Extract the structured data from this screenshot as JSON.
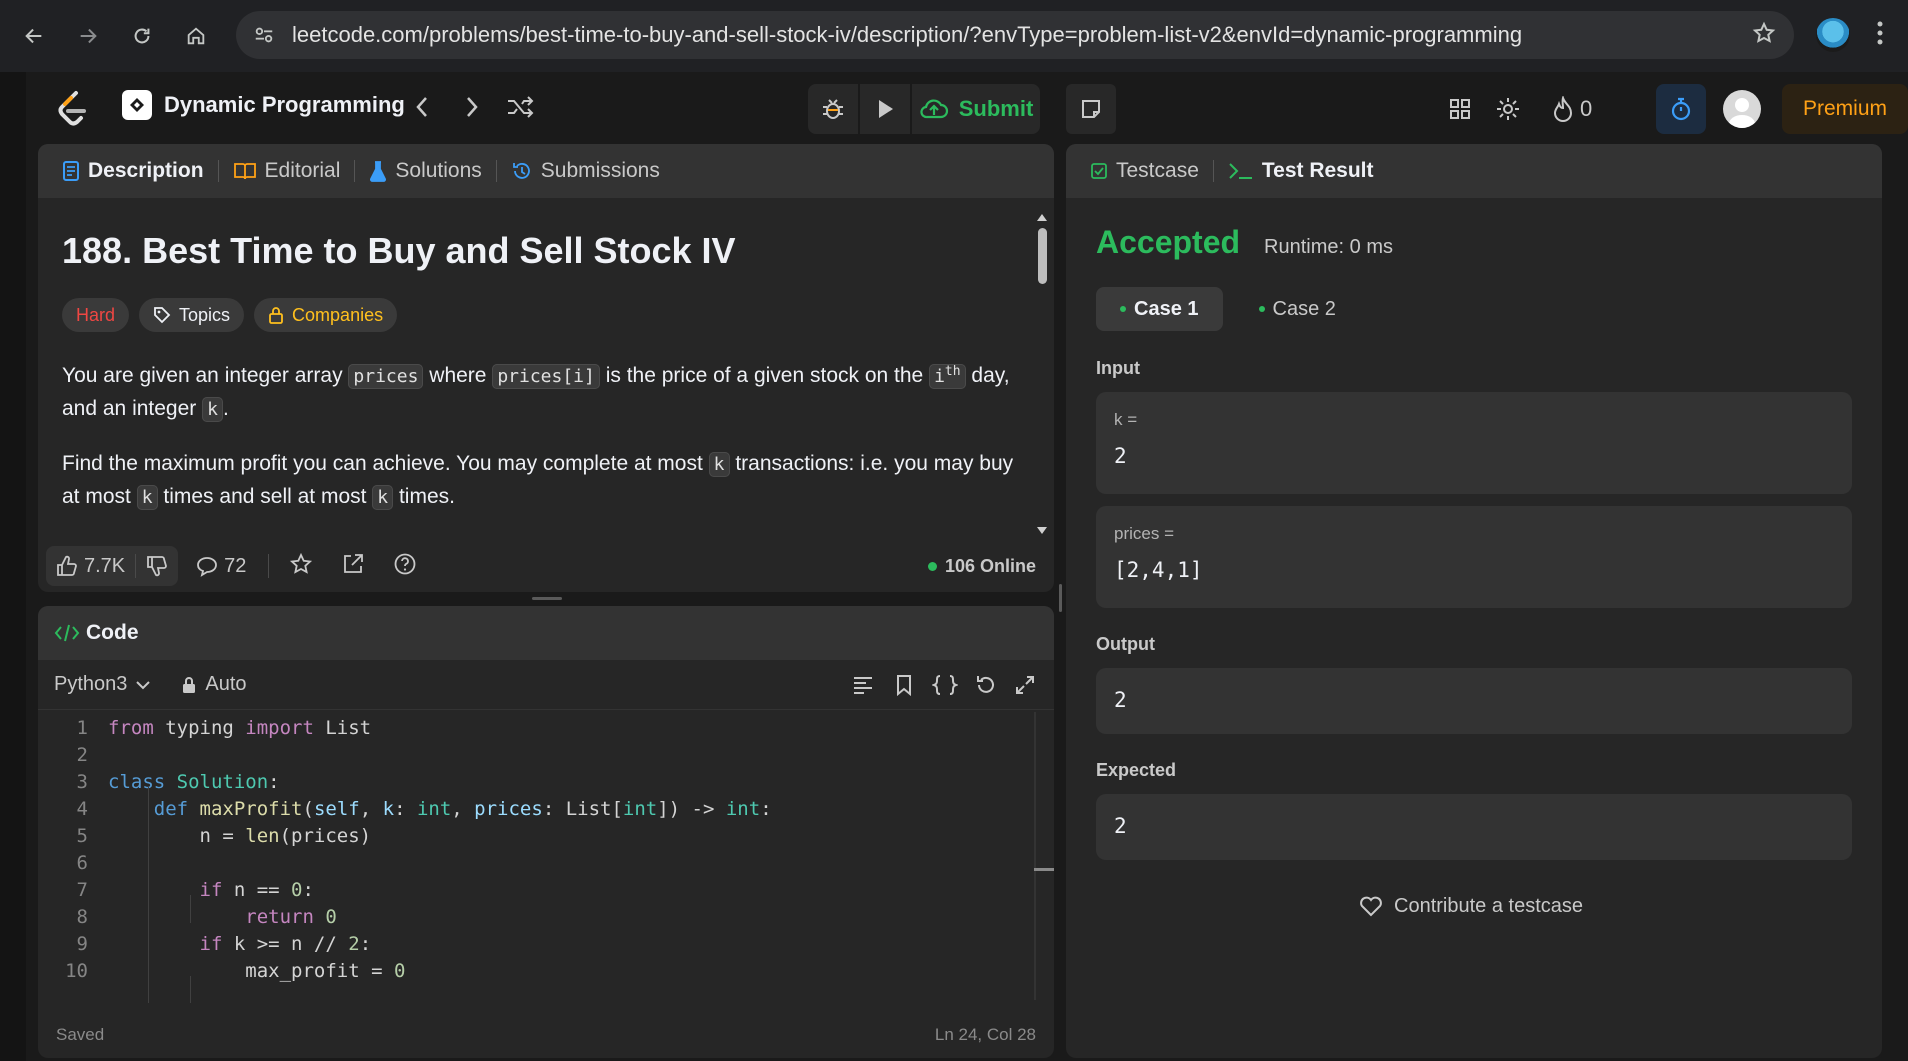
{
  "browser": {
    "url": "leetcode.com/problems/best-time-to-buy-and-sell-stock-iv/description/?envType=problem-list-v2&envId=dynamic-programming"
  },
  "topnav": {
    "study_plan_title": "Dynamic Programming",
    "submit_label": "Submit",
    "streak_count": "0",
    "premium_label": "Premium"
  },
  "description_panel": {
    "tabs": [
      {
        "label": "Description"
      },
      {
        "label": "Editorial"
      },
      {
        "label": "Solutions"
      },
      {
        "label": "Submissions"
      }
    ],
    "title": "188. Best Time to Buy and Sell Stock IV",
    "tags": {
      "difficulty": "Hard",
      "topics": "Topics",
      "companies": "Companies"
    },
    "para1": {
      "t1": "You are given an integer array ",
      "c1": "prices",
      "t2": " where ",
      "c2": "prices[i]",
      "t3": " is the price of a given stock on the ",
      "c3": "i",
      "c3sup": "th",
      "t4": " day,",
      "t5": "and an integer ",
      "c4": "k",
      "t6": "."
    },
    "para2": {
      "t1": "Find the maximum profit you can achieve. You may complete at most ",
      "c1": "k",
      "t2": " transactions: i.e. you may buy",
      "t3": "at most ",
      "c2": "k",
      "t4": " times and sell at most ",
      "c3": "k",
      "t5": " times."
    },
    "footer": {
      "likes": "7.7K",
      "comments": "72",
      "online": "106 Online"
    }
  },
  "code_panel": {
    "title": "Code",
    "language": "Python3",
    "mode": "Auto",
    "status": "Saved",
    "cursor": "Ln 24, Col 28",
    "line_numbers": [
      "1",
      "2",
      "3",
      "4",
      "5",
      "6",
      "7",
      "8",
      "9",
      "10"
    ]
  },
  "result_panel": {
    "tabs": [
      {
        "label": "Testcase"
      },
      {
        "label": "Test Result"
      }
    ],
    "status": "Accepted",
    "runtime": "Runtime: 0 ms",
    "cases": [
      {
        "label": "Case 1"
      },
      {
        "label": "Case 2"
      }
    ],
    "input_label": "Input",
    "inputs": [
      {
        "name": "k =",
        "value": "2"
      },
      {
        "name": "prices =",
        "value": "[2,4,1]"
      }
    ],
    "output_label": "Output",
    "output_value": "2",
    "expected_label": "Expected",
    "expected_value": "2",
    "contribute_label": "Contribute a testcase"
  },
  "colors": {
    "accepted": "#2cbb5d",
    "hard": "#ef4743",
    "companies": "#ffc01e",
    "premium": "#ffa116"
  }
}
